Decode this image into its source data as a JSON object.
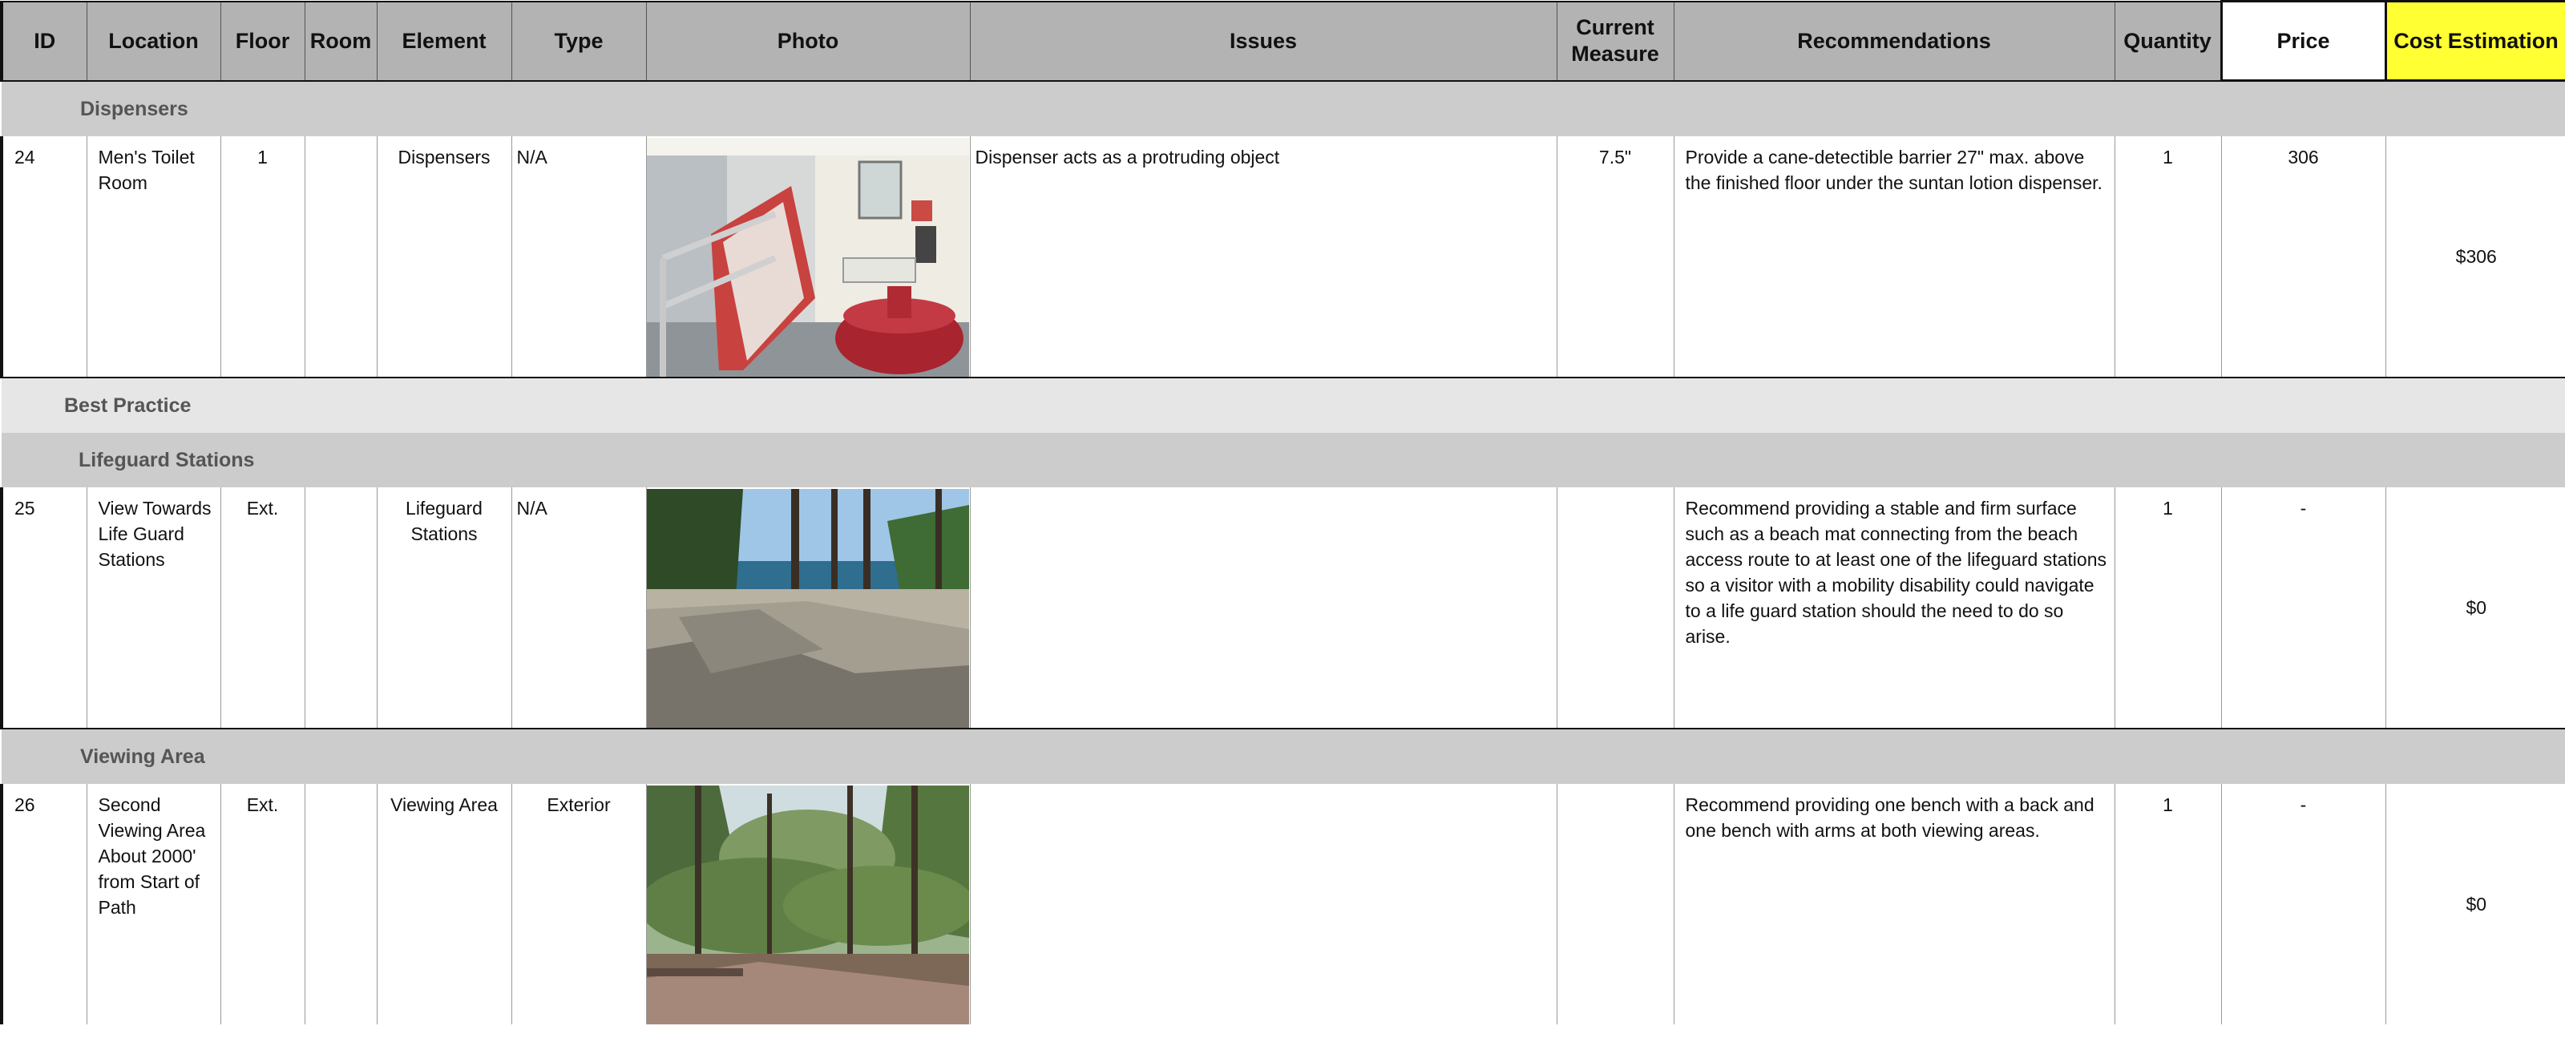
{
  "columns": {
    "id": "ID",
    "location": "Location",
    "floor": "Floor",
    "room": "Room",
    "element": "Element",
    "type": "Type",
    "photo": "Photo",
    "issues": "Issues",
    "current_measure": "Current Measure",
    "recommendations": "Recommendations",
    "quantity": "Quantity",
    "price": "Price",
    "cost_estimation": "Cost Estimation"
  },
  "sections": {
    "dispensers": "Dispensers",
    "best_practice": "Best Practice",
    "lifeguard": "Lifeguard Stations",
    "viewing": "Viewing Area"
  },
  "rows": [
    {
      "id": "24",
      "location": "Men's Toilet Room",
      "floor": "1",
      "room": "",
      "element": "Dispensers",
      "type": "N/A",
      "issues": "Dispenser acts as a protruding object",
      "current_measure": "7.5\"",
      "recommendations": "Provide a cane-detectible barrier 27\" max. above the finished floor under the suntan lotion dispenser.",
      "quantity": "1",
      "price": "306",
      "cost": "$306"
    },
    {
      "id": "25",
      "location": "View Towards Life Guard Stations",
      "floor": "Ext.",
      "room": "",
      "element": "Lifeguard Stations",
      "type": "N/A",
      "issues": "",
      "current_measure": "",
      "recommendations": "Recommend providing a stable and firm surface such as a beach mat connecting from the beach access route to at least one of the lifeguard stations so a visitor with a mobility disability could navigate to a life guard station should the need to do so arise.",
      "quantity": "1",
      "price": "-",
      "cost": "$0"
    },
    {
      "id": "26",
      "location": "Second Viewing Area About 2000' from Start of Path",
      "floor": "Ext.",
      "room": "",
      "element": "Viewing Area",
      "type": "Exterior",
      "issues": "",
      "current_measure": "",
      "recommendations": "Recommend providing one bench with a back and one bench with arms at both viewing areas.",
      "quantity": "1",
      "price": "-",
      "cost": "$0"
    }
  ]
}
